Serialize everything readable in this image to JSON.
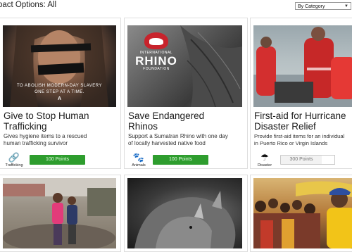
{
  "header": {
    "title": "pact Options: All",
    "sort_label": "By Category"
  },
  "cards": [
    {
      "image_caption_line1": "TO ABOLISH MODERN-DAY SLAVERY",
      "image_caption_line2": "ONE STEP AT A TIME.",
      "image_logo": "A",
      "title_line1": "Give to Stop Human",
      "title_line2": "Trafficking",
      "desc_line1": "Gives hygiene items to a rescued",
      "desc_line2": "human trafficking survivor",
      "category": "Trafficking",
      "category_icon": "link-icon",
      "points_label": "100 Points"
    },
    {
      "logo_line1": "INTERNATIONAL",
      "logo_line2": "RHINO",
      "logo_line3": "FOUNDATION",
      "title_line1": "Save Endangered",
      "title_line2": "Rhinos",
      "desc_line1": "Support a Sumatran Rhino with one day",
      "desc_line2": "of locally harvested native food",
      "category": "Animals",
      "category_icon": "paw-icon",
      "points_label": "100 Points"
    },
    {
      "title_line1": "First-aid for Hurricane",
      "title_line2": "Disaster Relief",
      "desc_line1": "Provide first-aid items for an individual",
      "desc_line2": "in Puerto Rico or Virgin Islands",
      "category": "Disaster",
      "category_icon": "parachute-icon",
      "points_label": "300 Points"
    }
  ],
  "colors": {
    "points_button": "#2e9d2e",
    "disabled_button": "#f2f2f2"
  }
}
